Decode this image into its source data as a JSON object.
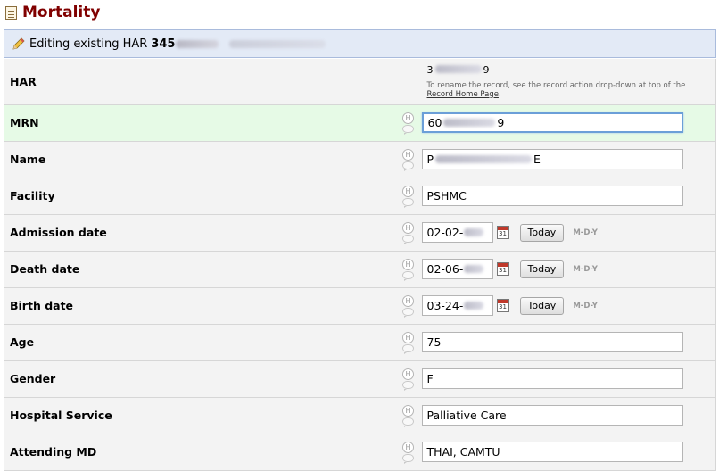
{
  "page": {
    "title": "Mortality"
  },
  "banner": {
    "prefix": "Editing existing HAR",
    "har_visible": "345"
  },
  "har": {
    "label": "HAR",
    "value_start": "3",
    "value_end": "9",
    "note": "To rename the record, see the record action drop-down at top of the",
    "link": "Record Home Page",
    "note_end": "."
  },
  "fields": {
    "mrn": {
      "label": "MRN",
      "value_start": "60",
      "value_end": "9"
    },
    "name": {
      "label": "Name",
      "value_start": "P",
      "value_end": "E"
    },
    "facility": {
      "label": "Facility",
      "value": "PSHMC"
    },
    "admission_date": {
      "label": "Admission date",
      "value": "02-02-"
    },
    "death_date": {
      "label": "Death date",
      "value": "02-06-"
    },
    "birth_date": {
      "label": "Birth date",
      "value": "03-24-"
    },
    "age": {
      "label": "Age",
      "value": "75"
    },
    "gender": {
      "label": "Gender",
      "value": "F"
    },
    "hospital_service": {
      "label": "Hospital Service",
      "value": "Palliative Care"
    },
    "attending_md": {
      "label": "Attending MD",
      "value": "THAI, CAMTU"
    }
  },
  "date_controls": {
    "today_label": "Today",
    "format_label": "M-D-Y",
    "calendar_day": "31"
  },
  "icons": {
    "history": "H",
    "history_icon": "history-icon",
    "comment_icon": "comment-icon",
    "calendar_icon": "calendar-icon"
  },
  "colors": {
    "title": "#800000",
    "banner_bg": "#e3eaf6",
    "active_row": "#e6fae6",
    "row_bg": "#f3f3f3"
  }
}
